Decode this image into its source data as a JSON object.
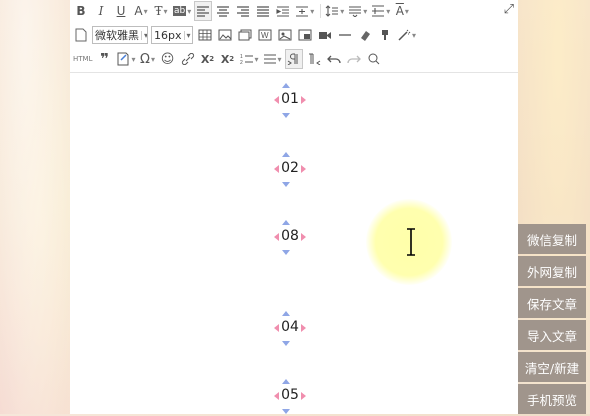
{
  "toolbar": {
    "font_family": "微软雅黑",
    "font_size": "16px",
    "html_label": "HTML"
  },
  "content": {
    "items": [
      "01",
      "02",
      "08",
      "04",
      "05"
    ]
  },
  "sidebar": {
    "buttons": [
      "微信复制",
      "外网复制",
      "保存文章",
      "导入文章",
      "清空/新建",
      "手机预览"
    ]
  },
  "colors": {
    "sidebar_button": "#a0958c",
    "arrow_vertical": "#8fa6e6",
    "arrow_horizontal": "#f08eae",
    "cursor_highlight": "#ffffaa"
  },
  "icons": [
    "bold-icon",
    "italic-icon",
    "underline-icon",
    "font-color-icon",
    "text-format-icon",
    "background-color-icon",
    "align-left-icon",
    "align-center-icon",
    "align-right-icon",
    "align-justify-icon",
    "indent-icon",
    "spacing-icon",
    "line-height-icon",
    "paragraph-spacing-icon",
    "clear-format-icon",
    "fullscreen-icon",
    "new-document-icon",
    "table-icon",
    "image-icon",
    "multi-image-icon",
    "word-icon",
    "picture-icon",
    "picture-alt-icon",
    "video-icon",
    "horizontal-line-icon",
    "eraser-icon",
    "format-brush-icon",
    "magic-wand-icon",
    "quote-icon",
    "template-icon",
    "special-char-icon",
    "emoji-icon",
    "link-icon",
    "superscript-icon",
    "subscript-icon",
    "ordered-list-icon",
    "unordered-list-icon",
    "ltr-icon",
    "rtl-icon",
    "undo-icon",
    "redo-icon",
    "find-icon"
  ]
}
